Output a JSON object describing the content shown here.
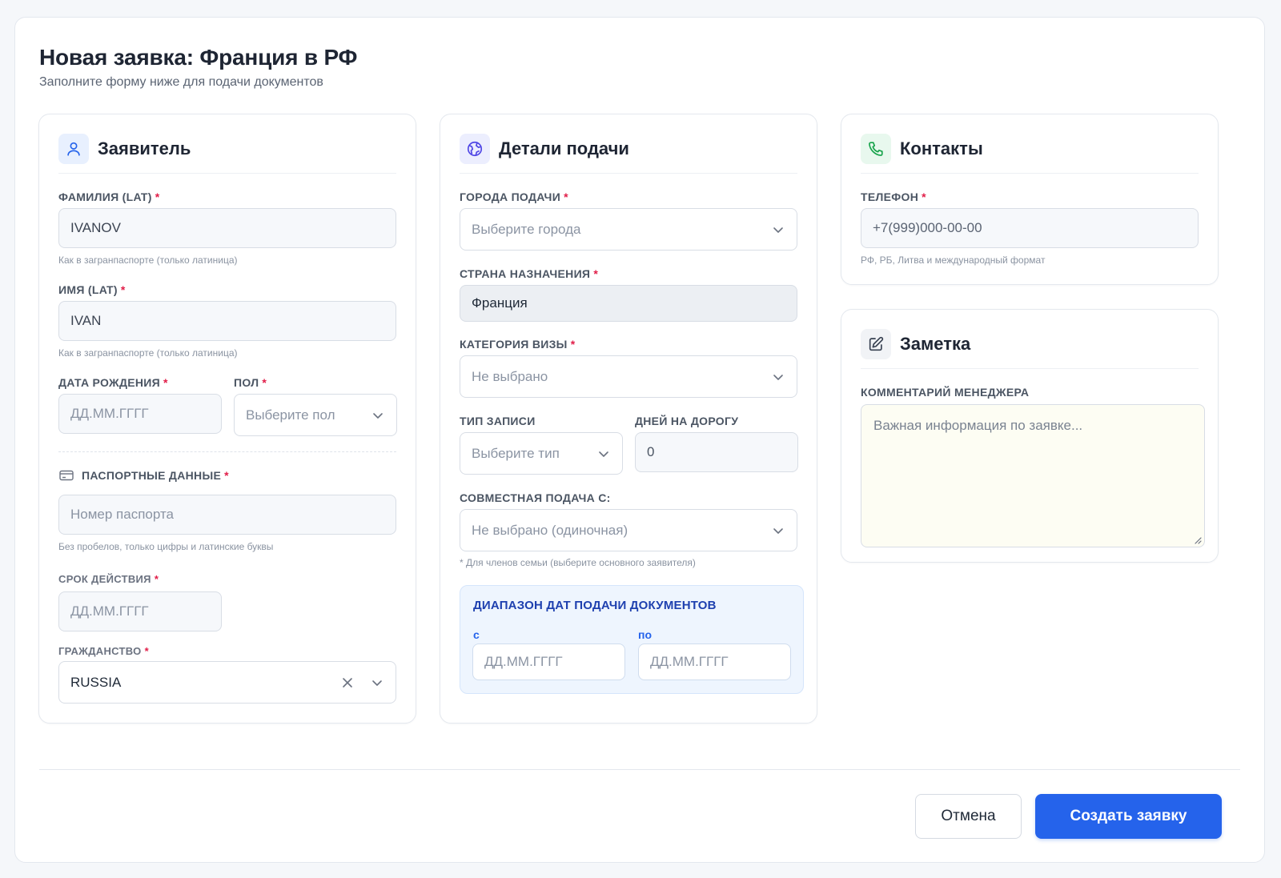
{
  "header": {
    "title": "Новая заявка: Франция в РФ",
    "subtitle": "Заполните форму ниже для подачи документов"
  },
  "applicant": {
    "title": "Заявитель",
    "icon": "user-icon",
    "surname_label": "ФАМИЛИЯ (LAT)",
    "surname_value": "IVANOV",
    "surname_hint": "Как в загранпаспорте (только латиница)",
    "name_label": "ИМЯ (LAT)",
    "name_value": "IVAN",
    "name_hint": "Как в загранпаспорте (только латиница)",
    "birth_label": "ДАТА РОЖДЕНИЯ",
    "birth_placeholder": "ДД.ММ.ГГГГ",
    "gender_label": "ПОЛ",
    "gender_placeholder": "Выберите пол",
    "passport_label": "ПАСПОРТНЫЕ ДАННЫЕ",
    "passport_placeholder": "Номер паспорта",
    "passport_hint": "Без пробелов, только цифры и латинские буквы",
    "validity_label": "СРОК ДЕЙСТВИЯ",
    "validity_placeholder": "ДД.ММ.ГГГГ",
    "citizenship_label": "ГРАЖДАНСТВО",
    "citizenship_value": "RUSSIA"
  },
  "submission": {
    "title": "Детали подачи",
    "icon": "globe-icon",
    "cities_label": "ГОРОДА ПОДАЧИ",
    "cities_placeholder": "Выберите города",
    "country_label": "СТРАНА НАЗНАЧЕНИЯ",
    "country_value": "Франция",
    "visa_label": "КАТЕГОРИЯ ВИЗЫ",
    "visa_placeholder": "Не выбрано",
    "record_label": "ТИП ЗАПИСИ",
    "record_placeholder": "Выберите тип",
    "days_label": "ДНЕЙ НА ДОРОГУ",
    "days_value": "0",
    "joint_label": "СОВМЕСТНАЯ ПОДАЧА С:",
    "joint_placeholder": "Не выбрано (одиночная)",
    "joint_hint": "* Для членов семьи (выберите основного заявителя)",
    "range_title": "ДИАПАЗОН ДАТ ПОДАЧИ ДОКУМЕНТОВ",
    "range_from_label": "с",
    "range_from_placeholder": "ДД.ММ.ГГГГ",
    "range_to_label": "по",
    "range_to_placeholder": "ДД.ММ.ГГГГ"
  },
  "contacts": {
    "title": "Контакты",
    "icon": "phone-icon",
    "phone_label": "ТЕЛЕФОН",
    "phone_placeholder": "+7(999)000-00-00",
    "phone_hint": "РФ, РБ, Литва и международный формат"
  },
  "note": {
    "title": "Заметка",
    "icon": "edit-icon",
    "comment_label": "КОММЕНТАРИЙ МЕНЕДЖЕРА",
    "comment_placeholder": "Важная информация по заявке..."
  },
  "footer": {
    "cancel_label": "Отмена",
    "submit_label": "Создать заявку"
  },
  "colors": {
    "primary": "#2563eb",
    "required": "#e11d48",
    "applicant_icon_bg": "#e8f0fe",
    "submission_icon_bg": "#eceefe",
    "contacts_icon_bg": "#e8f8ee",
    "note_icon_bg": "#f1f3f6",
    "note_bg": "#fdfdf3"
  }
}
